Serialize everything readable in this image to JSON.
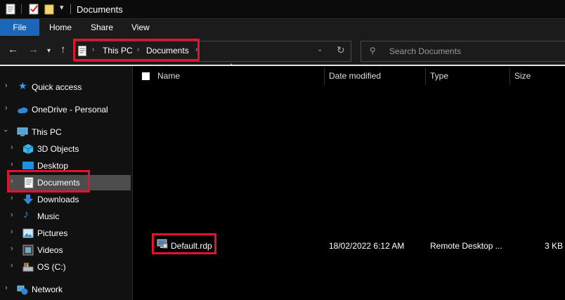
{
  "window": {
    "title": "Documents"
  },
  "ribbon": {
    "tabs": [
      {
        "label": "File"
      },
      {
        "label": "Home"
      },
      {
        "label": "Share"
      },
      {
        "label": "View"
      }
    ]
  },
  "address": {
    "crumbs": [
      "This PC",
      "Documents"
    ],
    "search_placeholder": "Search Documents"
  },
  "nav": {
    "items": [
      {
        "label": "Quick access"
      },
      {
        "label": "OneDrive - Personal"
      },
      {
        "label": "This PC"
      },
      {
        "label": "3D Objects"
      },
      {
        "label": "Desktop"
      },
      {
        "label": "Documents"
      },
      {
        "label": "Downloads"
      },
      {
        "label": "Music"
      },
      {
        "label": "Pictures"
      },
      {
        "label": "Videos"
      },
      {
        "label": "OS (C:)"
      },
      {
        "label": "Network"
      }
    ]
  },
  "columns": {
    "name": "Name",
    "date": "Date modified",
    "type": "Type",
    "size": "Size"
  },
  "files": [
    {
      "name": "Default.rdp",
      "date": "18/02/2022 6:12 AM",
      "type": "Remote Desktop ...",
      "size": "3 KB"
    }
  ],
  "colors": {
    "highlight": "#e8112d",
    "file_tab": "#1a66b8",
    "selected_nav": "#4d4d4d"
  }
}
